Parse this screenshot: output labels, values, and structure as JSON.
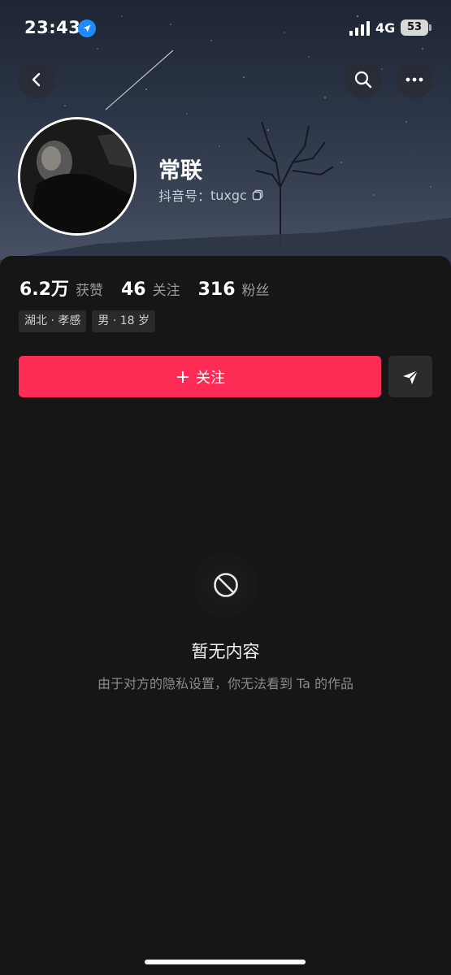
{
  "status_bar": {
    "time": "23:43",
    "network": "4G",
    "battery": "53"
  },
  "profile": {
    "name": "常联",
    "douyin_id_label": "抖音号：",
    "douyin_id": "tuxgc"
  },
  "stats": [
    {
      "value": "6.2万",
      "label": "获赞"
    },
    {
      "value": "46",
      "label": "关注"
    },
    {
      "value": "316",
      "label": "粉丝"
    }
  ],
  "tags": [
    "湖北 · 孝感",
    "男 · 18 岁"
  ],
  "actions": {
    "follow_label": "关注"
  },
  "empty_state": {
    "title": "暂无内容",
    "description": "由于对方的隐私设置，你无法看到 Ta 的作品"
  },
  "colors": {
    "accent": "#fe2c55",
    "background": "#161616"
  },
  "icons": {
    "back": "chevron-left-icon",
    "search": "search-icon",
    "more": "more-icon",
    "share": "send-icon",
    "empty": "no-entry-icon",
    "copy": "copy-icon"
  }
}
